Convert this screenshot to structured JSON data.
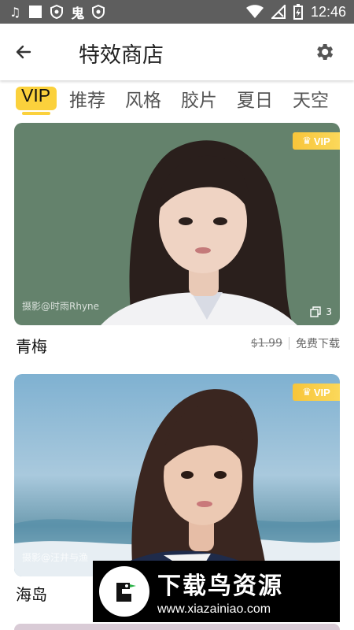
{
  "status_bar": {
    "time": "12:46",
    "left_icons": [
      "music-note-icon",
      "square-notification-icon",
      "shield-icon",
      "app-ghost-icon",
      "shield-icon"
    ],
    "right_icons": [
      "wifi-icon",
      "signal-icon",
      "battery-charging-icon"
    ]
  },
  "app_bar": {
    "title": "特效商店",
    "back_icon": "arrow-left-icon",
    "settings_icon": "gear-icon"
  },
  "tabs": [
    {
      "label": "VIP",
      "active": true
    },
    {
      "label": "推荐",
      "active": false
    },
    {
      "label": "风格",
      "active": false
    },
    {
      "label": "胶片",
      "active": false
    },
    {
      "label": "夏日",
      "active": false
    },
    {
      "label": "天空",
      "active": false
    }
  ],
  "colors": {
    "accent": "#fbd13c",
    "vip_badge": "#f8c53a",
    "card1_bg": "#64826c",
    "card2_bg": "#7fa7c4"
  },
  "cards": [
    {
      "name": "青梅",
      "badge": "VIP",
      "watermark": "摄影@时雨Rhyne",
      "count": "3",
      "old_price": "$1.99",
      "action": "免费下载"
    },
    {
      "name": "海岛",
      "badge": "VIP",
      "watermark": "摄影@汪井与渔"
    }
  ],
  "promo": {
    "title": "下载鸟资源",
    "url": "www.xiazainiao.com"
  }
}
